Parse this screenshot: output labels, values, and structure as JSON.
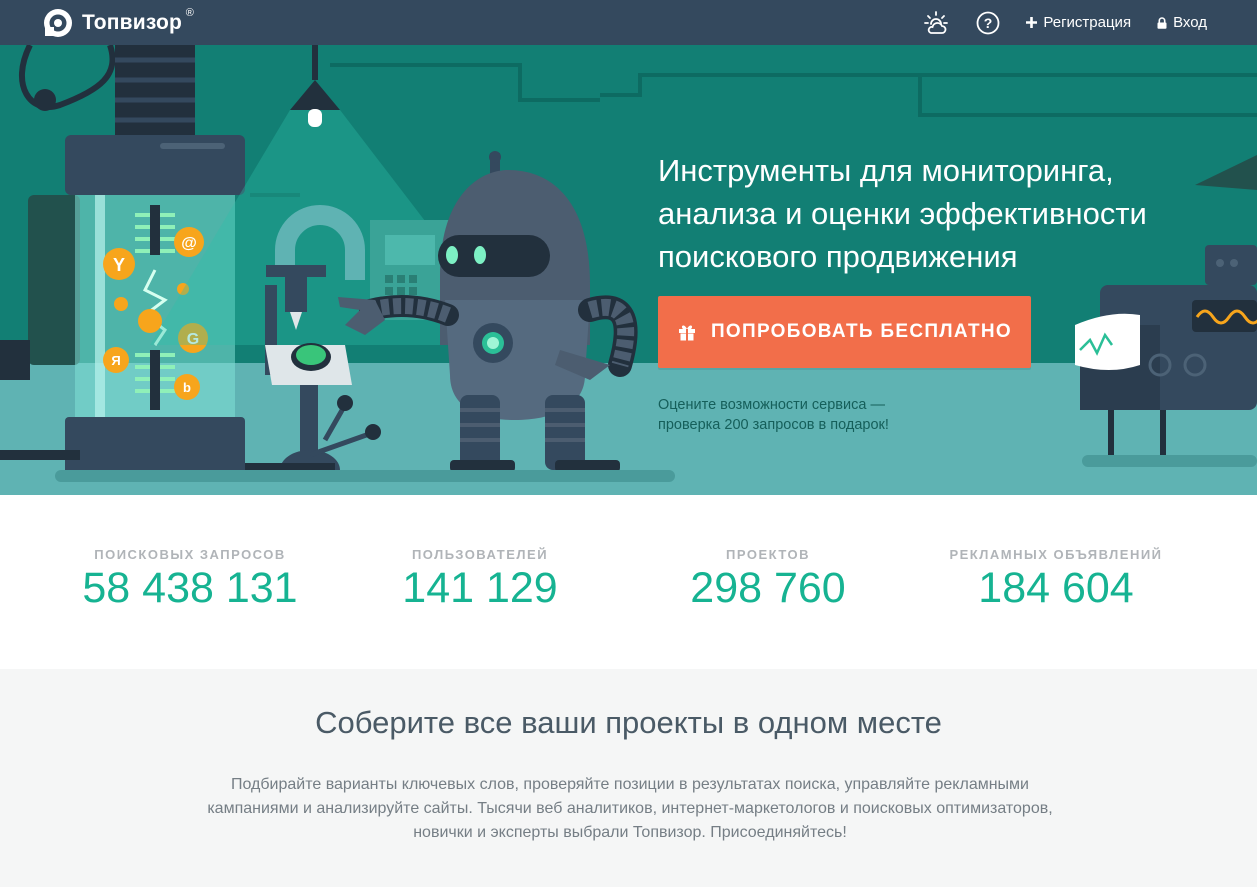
{
  "header": {
    "logo_text": "Топвизор",
    "logo_mark": "®",
    "nav": {
      "register_label": "Регистрация",
      "login_label": "Вход"
    }
  },
  "hero": {
    "title_lines": [
      "Инструменты для мониторинга,",
      "анализа и оценки эффективности",
      "поискового продвижения"
    ],
    "cta_label": "ПОПРОБОВАТЬ БЕСПЛАТНО",
    "note_lines": [
      "Оцените возможности сервиса —",
      "проверка 200 запросов в подарок!"
    ],
    "engine_glyphs": [
      "Y",
      "@",
      "G",
      "Я",
      "b"
    ]
  },
  "stats": [
    {
      "label": "ПОИСКОВЫХ ЗАПРОСОВ",
      "value": "58 438 131"
    },
    {
      "label": "ПОЛЬЗОВАТЕЛЕЙ",
      "value": "141 129"
    },
    {
      "label": "ПРОЕКТОВ",
      "value": "298 760"
    },
    {
      "label": "РЕКЛАМНЫХ ОБЪЯВЛЕНИЙ",
      "value": "184 604"
    }
  ],
  "about": {
    "title": "Соберите все ваши проекты в одном месте",
    "text_lines": [
      "Подбирайте варианты ключевых слов, проверяйте позиции в результатах поиска, управляйте рекламными",
      "кампаниями и анализируйте сайты. Тысячи веб аналитиков, интернет-маркетологов и поисковых оптимизаторов,",
      "новички и эксперты выбрали Топвизор. Присоединяйтесь!"
    ]
  },
  "icons": {
    "logo": "topvisor-logo-icon",
    "weather": "weather-cloud-sun-icon",
    "help": "help-circle-icon",
    "plus": "plus-icon",
    "lock": "lock-icon",
    "gift": "gift-icon"
  },
  "colors": {
    "topbar": "#34495e",
    "hero_bg": "#127f74",
    "accent": "#f26e4a",
    "stat_value": "#16b392"
  }
}
